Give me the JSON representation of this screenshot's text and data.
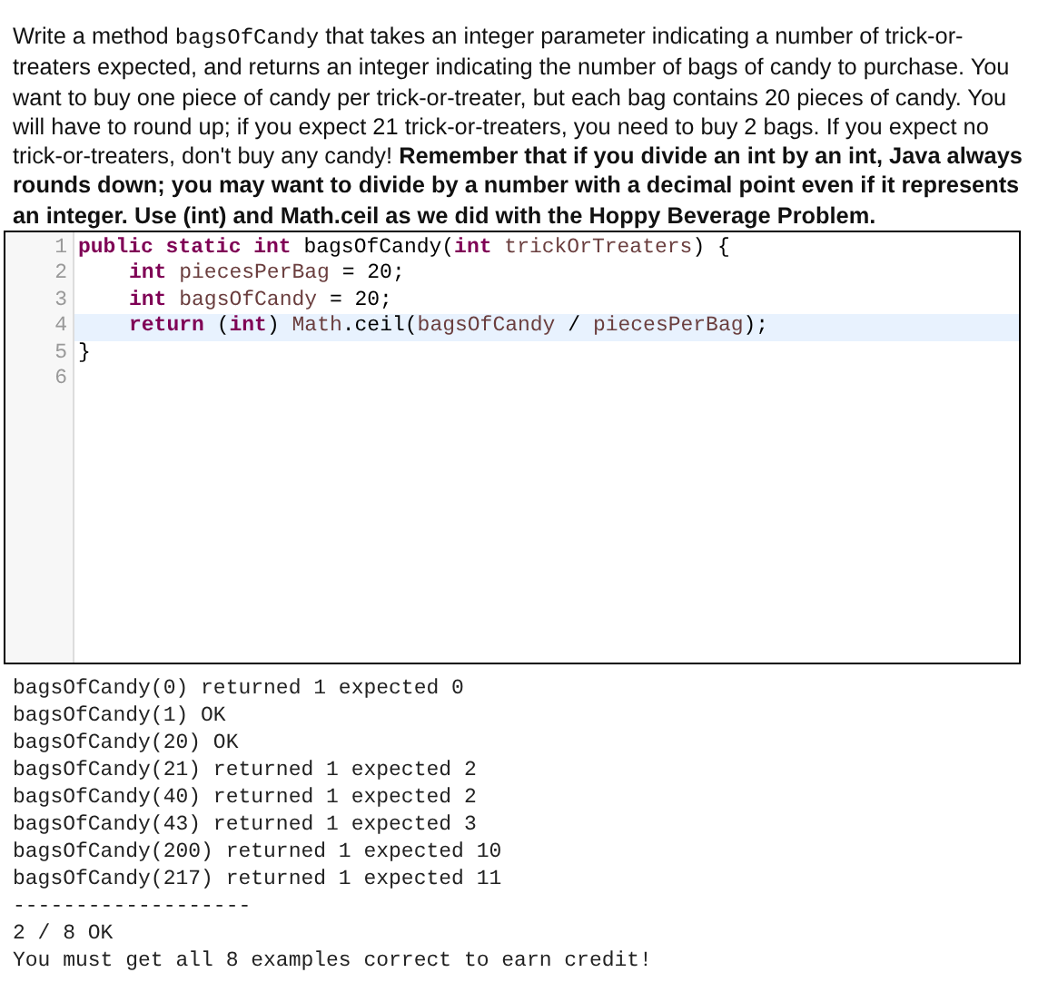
{
  "prompt": [
    {
      "kind": "text",
      "text": "Write a method "
    },
    {
      "kind": "code",
      "text": "bagsOfCandy"
    },
    {
      "kind": "text",
      "text": " that takes an integer parameter indicating a number of trick-or-treaters expected, and returns an integer indicating the number of bags of candy to purchase. You want to buy one piece of candy per trick-or-treater, but each bag contains 20 pieces of candy. You will have to round up; if you expect 21 trick-or-treaters, you need to buy 2 bags. If you expect no trick-or-treaters, don't buy any candy! "
    },
    {
      "kind": "bold",
      "text": "Remember that if you divide an int by an int, Java always rounds down; you may want to divide by a number with a decimal point even if it represents an integer. Use (int) and Math.ceil as we did with the Hoppy Beverage Problem."
    }
  ],
  "editor": {
    "lines": [
      {
        "number": "1",
        "highlighted": false,
        "indented": false,
        "tokens": [
          {
            "kind": "keyword",
            "text": "public static int"
          },
          {
            "kind": "plain",
            "text": " bagsOfCandy("
          },
          {
            "kind": "keyword",
            "text": "int"
          },
          {
            "kind": "variable",
            "text": " trickOrTreaters"
          },
          {
            "kind": "plain",
            "text": ") {"
          }
        ]
      },
      {
        "number": "2",
        "highlighted": false,
        "indented": true,
        "tokens": [
          {
            "kind": "keyword",
            "text": "int"
          },
          {
            "kind": "variable",
            "text": " piecesPerBag"
          },
          {
            "kind": "plain",
            "text": " = 20;"
          }
        ]
      },
      {
        "number": "3",
        "highlighted": false,
        "indented": true,
        "tokens": [
          {
            "kind": "keyword",
            "text": "int"
          },
          {
            "kind": "variable",
            "text": " bagsOfCandy"
          },
          {
            "kind": "plain",
            "text": " = 20;"
          }
        ]
      },
      {
        "number": "4",
        "highlighted": true,
        "indented": true,
        "tokens": [
          {
            "kind": "keyword",
            "text": "return"
          },
          {
            "kind": "plain",
            "text": " ("
          },
          {
            "kind": "keyword",
            "text": "int"
          },
          {
            "kind": "plain",
            "text": ") "
          },
          {
            "kind": "variable",
            "text": "Math"
          },
          {
            "kind": "plain",
            "text": ".ceil("
          },
          {
            "kind": "variable",
            "text": "bagsOfCandy"
          },
          {
            "kind": "plain",
            "text": " / "
          },
          {
            "kind": "variable",
            "text": "piecesPerBag"
          },
          {
            "kind": "plain",
            "text": ");"
          }
        ]
      },
      {
        "number": "5",
        "highlighted": false,
        "indented": false,
        "tokens": [
          {
            "kind": "plain",
            "text": "}"
          }
        ]
      },
      {
        "number": "6",
        "highlighted": false
      }
    ]
  },
  "output": [
    "bagsOfCandy(0) returned 1 expected 0",
    "bagsOfCandy(1) OK",
    "bagsOfCandy(20) OK",
    "bagsOfCandy(21) returned 1 expected 2",
    "bagsOfCandy(40) returned 1 expected 2",
    "bagsOfCandy(43) returned 1 expected 3",
    "bagsOfCandy(200) returned 1 expected 10",
    "bagsOfCandy(217) returned 1 expected 11",
    "-------------------",
    "2 / 8 OK",
    "You must get all 8 examples correct to earn credit!"
  ]
}
